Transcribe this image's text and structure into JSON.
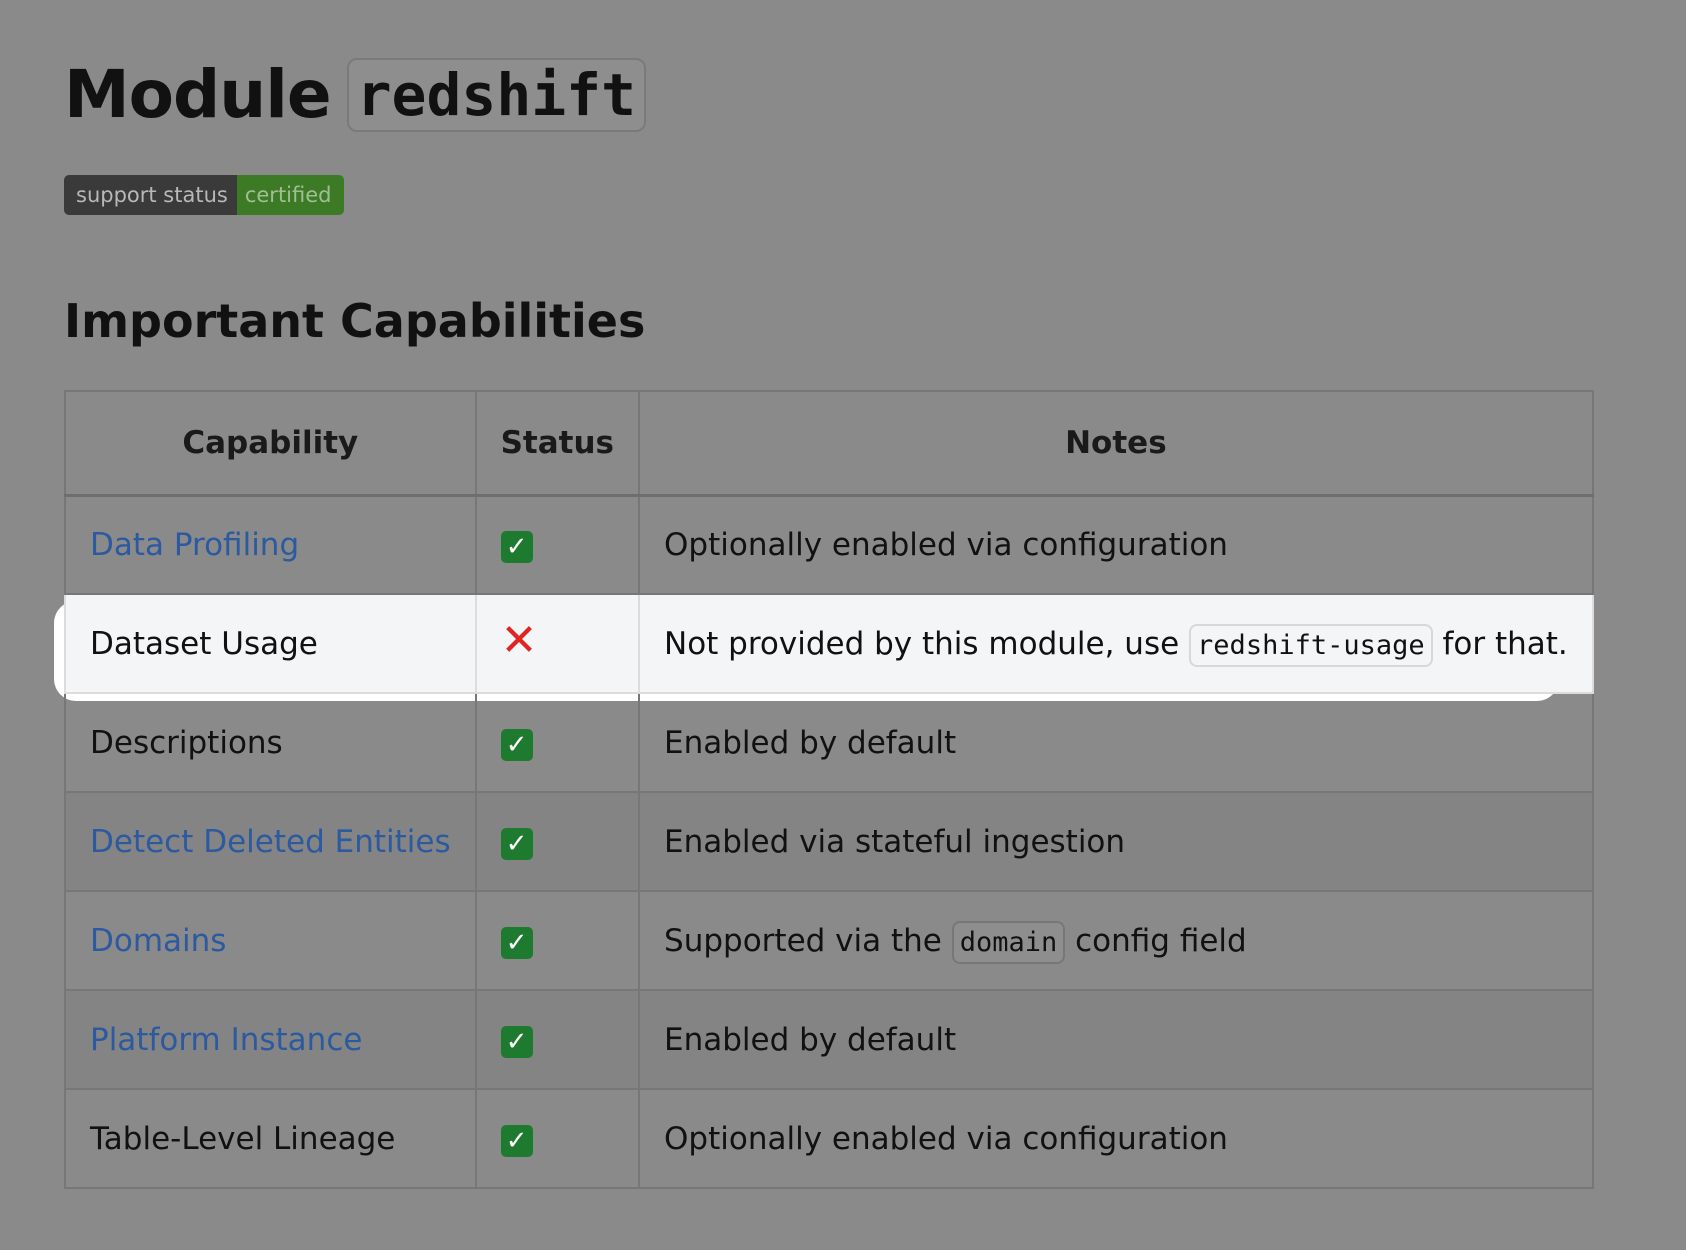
{
  "header": {
    "title_prefix": "Module",
    "title_code": "redshift"
  },
  "badge": {
    "label": "support status",
    "value": "certified"
  },
  "section": {
    "title": "Important Capabilities"
  },
  "table": {
    "columns": [
      "Capability",
      "Status",
      "Notes"
    ],
    "rows": [
      {
        "capability": "Data Profiling",
        "is_link": true,
        "status": "check",
        "notes_before": "Optionally enabled via configuration",
        "notes_code": "",
        "notes_after": ""
      },
      {
        "capability": "Dataset Usage",
        "is_link": false,
        "status": "cross",
        "notes_before": "Not provided by this module, use ",
        "notes_code": "redshift-usage",
        "notes_after": " for that."
      },
      {
        "capability": "Descriptions",
        "is_link": false,
        "status": "check",
        "notes_before": "Enabled by default",
        "notes_code": "",
        "notes_after": ""
      },
      {
        "capability": "Detect Deleted Entities",
        "is_link": true,
        "status": "check",
        "notes_before": "Enabled via stateful ingestion",
        "notes_code": "",
        "notes_after": ""
      },
      {
        "capability": "Domains",
        "is_link": true,
        "status": "check",
        "notes_before": "Supported via the ",
        "notes_code": "domain",
        "notes_after": " config field"
      },
      {
        "capability": "Platform Instance",
        "is_link": true,
        "status": "check",
        "notes_before": "Enabled by default",
        "notes_code": "",
        "notes_after": ""
      },
      {
        "capability": "Table-Level Lineage",
        "is_link": false,
        "status": "check",
        "notes_before": "Optionally enabled via configuration",
        "notes_code": "",
        "notes_after": ""
      }
    ]
  },
  "icons": {
    "check": "✓",
    "cross": "✕"
  },
  "colors": {
    "link": "#2c5aa0",
    "check_bg": "#1e7a2e",
    "cross": "#e0241f",
    "badge_value_bg": "#3d7a26"
  }
}
